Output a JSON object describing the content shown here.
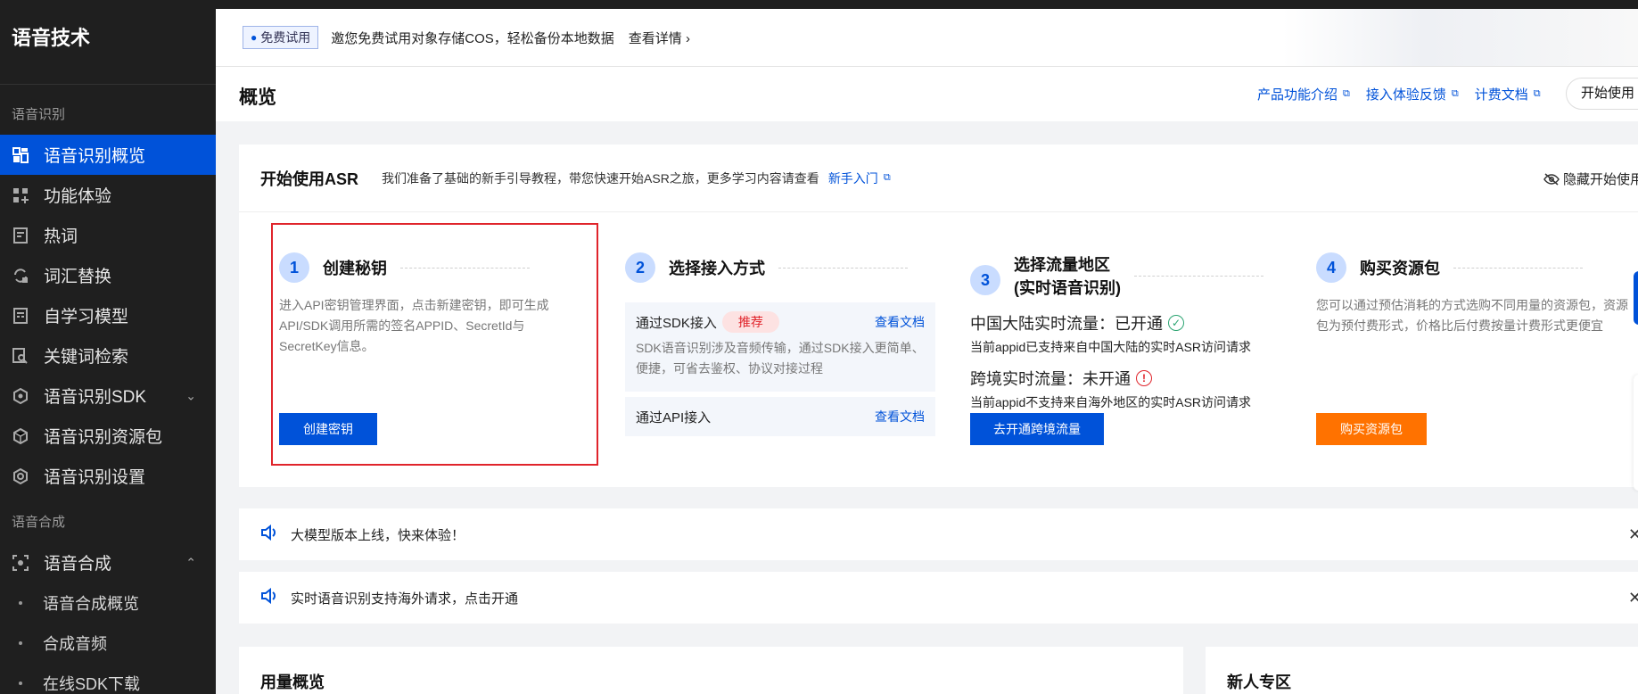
{
  "sidebar": {
    "brand": "语音技术",
    "group_recognition": "语音识别",
    "items": [
      {
        "label": "语音识别概览",
        "icon": "dashboard-icon"
      },
      {
        "label": "功能体验",
        "icon": "apps-icon"
      },
      {
        "label": "热词",
        "icon": "hotword-icon"
      },
      {
        "label": "词汇替换",
        "icon": "replace-icon"
      },
      {
        "label": "自学习模型",
        "icon": "model-icon"
      },
      {
        "label": "关键词检索",
        "icon": "search-doc-icon"
      },
      {
        "label": "语音识别SDK",
        "icon": "sdk-icon"
      },
      {
        "label": "语音识别资源包",
        "icon": "package-icon"
      },
      {
        "label": "语音识别设置",
        "icon": "settings-icon"
      }
    ],
    "group_synthesis": "语音合成",
    "synthesis": {
      "label": "语音合成",
      "icon": "synthesis-icon"
    },
    "sub_items": [
      "语音合成概览",
      "合成音频",
      "在线SDK下载"
    ]
  },
  "banner": {
    "tag": "免费试用",
    "text": "邀您免费试用对象存储COS，轻松备份本地数据",
    "link": "查看详情"
  },
  "header": {
    "title": "概览",
    "links": [
      "产品功能介绍",
      "接入体验反馈",
      "计费文档"
    ],
    "start": "开始使用"
  },
  "asr_card": {
    "title": "开始使用ASR",
    "desc": "我们准备了基础的新手引导教程，带您快速开始ASR之旅，更多学习内容请查看",
    "guide_link": "新手入门",
    "hide_label": "隐藏开始使用",
    "steps": {
      "s1": {
        "num": "1",
        "title": "创建秘钥",
        "desc": "进入API密钥管理界面，点击新建密钥，即可生成API/SDK调用所需的签名APPID、SecretId与SecretKey信息。",
        "button": "创建密钥"
      },
      "s2": {
        "num": "2",
        "title": "选择接入方式",
        "sdk_label": "通过SDK接入",
        "sdk_badge": "推荐",
        "sdk_doc": "查看文档",
        "sdk_desc": "SDK语音识别涉及音频传输，通过SDK接入更简单、便捷，可省去鉴权、协议对接过程",
        "api_label": "通过API接入",
        "api_doc": "查看文档"
      },
      "s3": {
        "num": "3",
        "title_line1": "选择流量地区",
        "title_line2": "(实时语音识别)",
        "cn_label": "中国大陆实时流量：已开通",
        "cn_desc": "当前appid已支持来自中国大陆的实时ASR访问请求",
        "intl_label": "跨境实时流量：未开通",
        "intl_desc": "当前appid不支持来自海外地区的实时ASR访问请求",
        "button": "去开通跨境流量"
      },
      "s4": {
        "num": "4",
        "title": "购买资源包",
        "desc": "您可以通过预估消耗的方式选购不同用量的资源包，资源包为预付费形式，价格比后付费按量计费形式更便宜",
        "button": "购买资源包"
      }
    }
  },
  "notices": [
    "大模型版本上线，快来体验！",
    "实时语音识别支持海外请求，点击开通"
  ],
  "bottom": {
    "usage_title": "用量概览",
    "newbie_title": "新人专区"
  },
  "colors": {
    "primary": "#0052d9",
    "orange": "#ff7200",
    "sidebar_bg": "#1f1f1f",
    "success": "#2ba471",
    "danger": "#e0242b"
  }
}
